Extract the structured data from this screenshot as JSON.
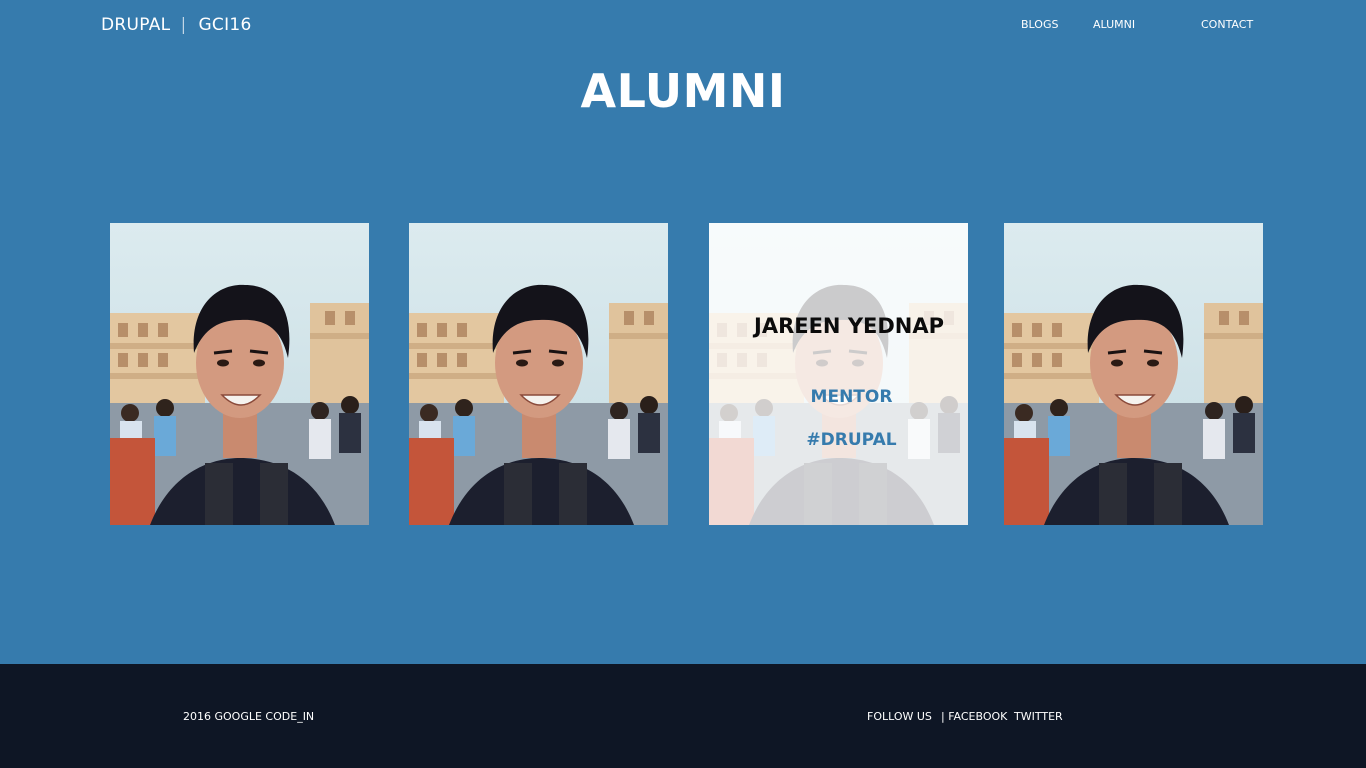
{
  "header": {
    "brand_primary": "DRUPAL",
    "brand_sep": "|",
    "brand_secondary": "GCI16",
    "nav": {
      "blogs": "BLOGS",
      "alumni": "ALUMNI",
      "contact": "CONTACT"
    }
  },
  "main": {
    "title": "ALUMNI",
    "featured_card": {
      "name": "JAREEN YEDNAP",
      "role": "MENTOR",
      "tag": "#DRUPAL"
    }
  },
  "footer": {
    "copyright": "2016 GOOGLE CODE_IN",
    "follow_label": "FOLLOW  US",
    "facebook": "| FACEBOOK",
    "twitter": "TWITTER"
  },
  "colors": {
    "background": "#367bad",
    "footer_bg": "#0e1625",
    "accent": "#367bad",
    "text_light": "#ffffff"
  }
}
